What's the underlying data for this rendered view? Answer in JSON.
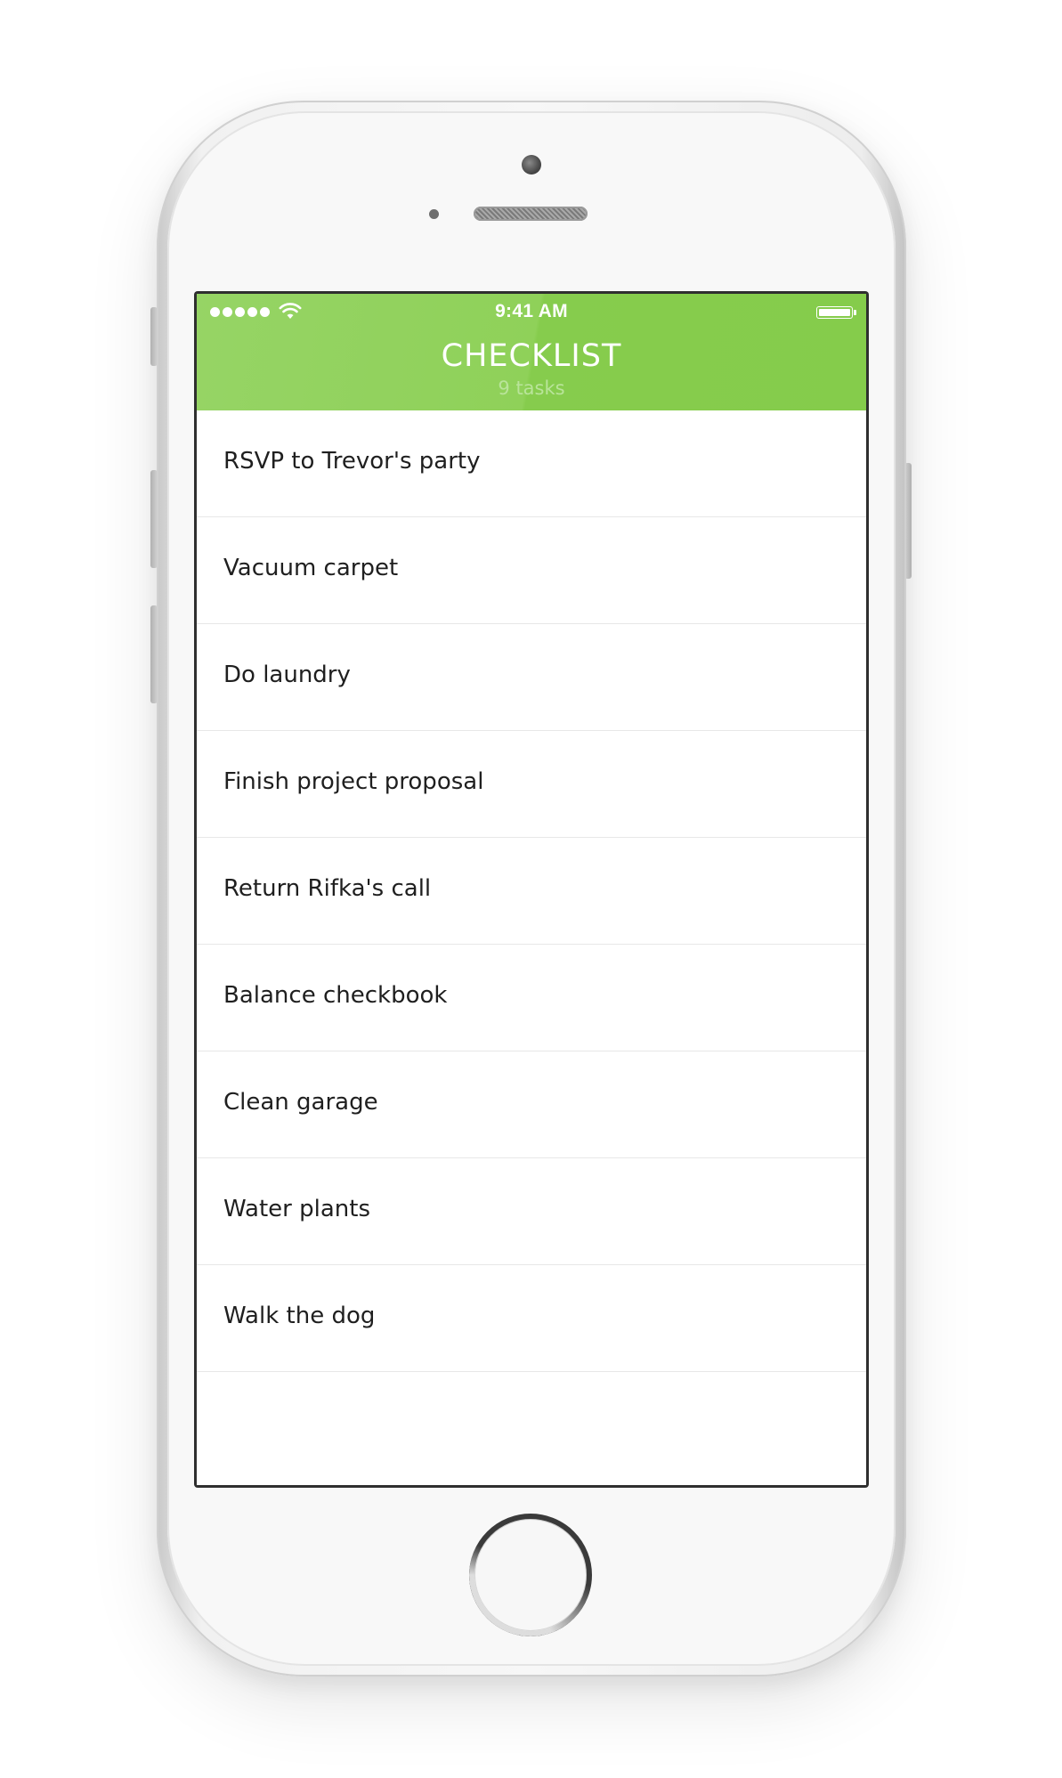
{
  "status_bar": {
    "signal_icon": "signal-dots-icon",
    "wifi_icon": "wifi-icon",
    "time": "9:41 AM",
    "battery_icon": "battery-icon"
  },
  "header": {
    "title": "CHECKLIST",
    "subtitle": "9 tasks",
    "background_color": "#8bcf55"
  },
  "tasks": [
    {
      "label": "RSVP to Trevor's party"
    },
    {
      "label": "Vacuum carpet"
    },
    {
      "label": "Do laundry"
    },
    {
      "label": "Finish project proposal"
    },
    {
      "label": "Return Rifka's call"
    },
    {
      "label": "Balance checkbook"
    },
    {
      "label": "Clean garage"
    },
    {
      "label": "Water plants"
    },
    {
      "label": "Walk the dog"
    }
  ],
  "device": {
    "home_button_icon": "home-button-icon"
  }
}
